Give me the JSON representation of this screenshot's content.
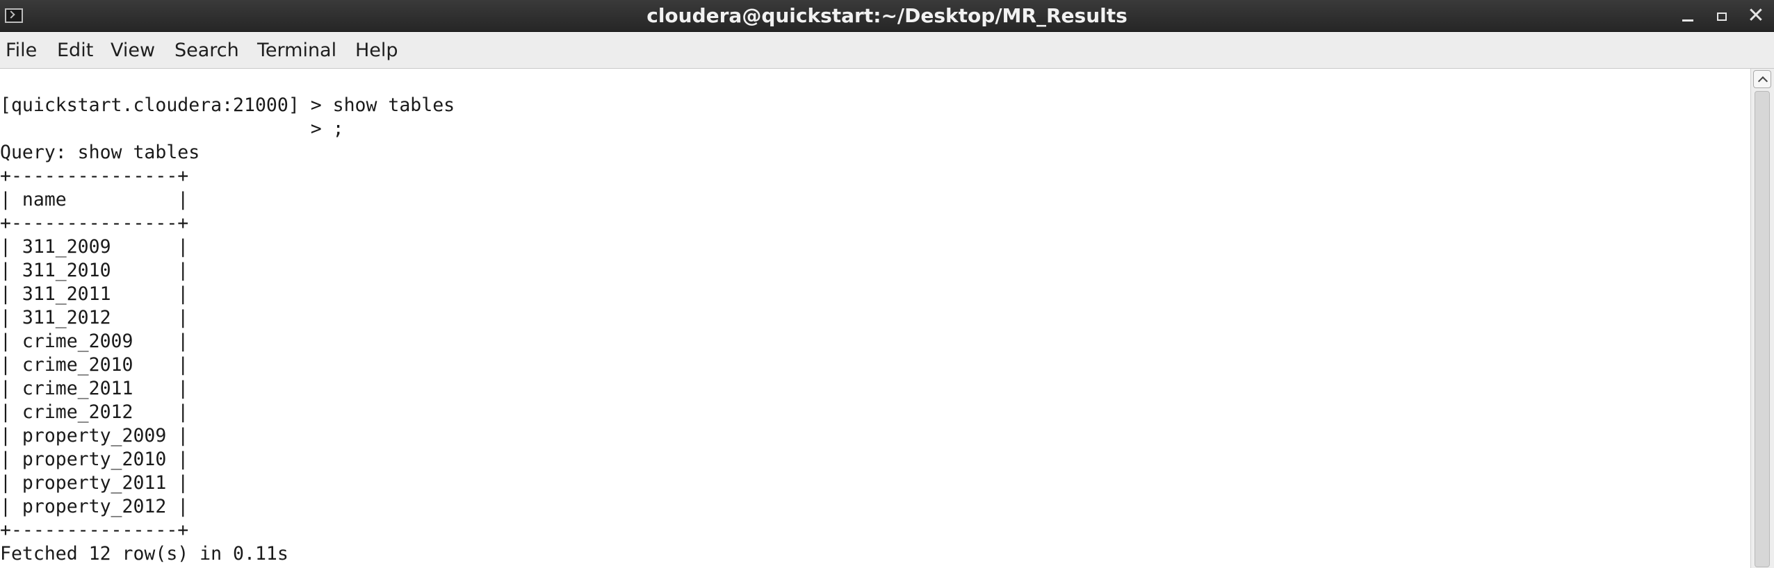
{
  "window": {
    "title": "cloudera@quickstart:~/Desktop/MR_Results",
    "controls": {
      "minimize_icon": "minimize-icon",
      "maximize_icon": "maximize-icon",
      "close_glyph": "✕"
    }
  },
  "menubar": {
    "items": [
      "File",
      "Edit",
      "View",
      "Search",
      "Terminal",
      "Help"
    ]
  },
  "terminal": {
    "lines": [
      "[quickstart.cloudera:21000] > show tables",
      "                            > ;",
      "Query: show tables",
      "+---------------+",
      "| name          |",
      "+---------------+",
      "| 311_2009      |",
      "| 311_2010      |",
      "| 311_2011      |",
      "| 311_2012      |",
      "| crime_2009    |",
      "| crime_2010    |",
      "| crime_2011    |",
      "| crime_2012    |",
      "| property_2009 |",
      "| property_2010 |",
      "| property_2011 |",
      "| property_2012 |",
      "+---------------+",
      "Fetched 12 row(s) in 0.11s"
    ]
  },
  "colors": {
    "titlebar_bg": "#2e2e2e",
    "titlebar_text": "#f2f2f2",
    "menubar_bg": "#ededed",
    "terminal_bg": "#ffffff",
    "terminal_text": "#1a1a1a"
  }
}
